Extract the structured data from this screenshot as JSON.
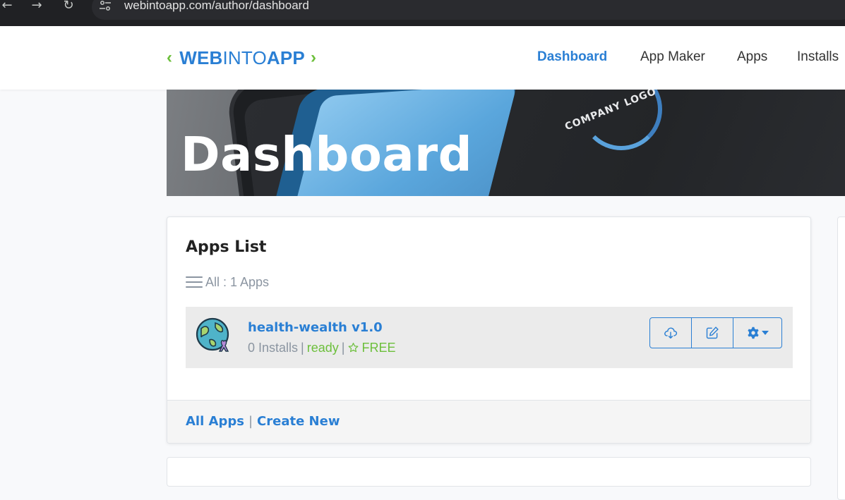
{
  "browser": {
    "url": "webintoapp.com/author/dashboard",
    "back_icon": "arrow-left-icon",
    "forward_icon": "arrow-right-icon",
    "reload_icon": "reload-icon"
  },
  "brand": {
    "logo_left_chevron": "‹",
    "logo_part1": "WEB",
    "logo_part2": "INTO",
    "logo_part3": "APP",
    "logo_right_chevron": "›",
    "primary_color": "#2a7fd4",
    "accent_color": "#6cbf3b"
  },
  "nav": {
    "items": [
      {
        "label": "Dashboard",
        "active": true
      },
      {
        "label": "App Maker",
        "active": false
      },
      {
        "label": "Apps",
        "active": false
      },
      {
        "label": "Installs",
        "active": false
      }
    ]
  },
  "hero": {
    "title": "Dashboard",
    "image_text": "COMPANY LOGO"
  },
  "apps_list": {
    "title": "Apps List",
    "filter_label": "All : 1 Apps",
    "apps": [
      {
        "name": "health-wealth v1.0",
        "installs": "0 Installs",
        "status": "ready",
        "plan": "FREE",
        "separator": "|"
      }
    ],
    "footer": {
      "all_apps": "All Apps",
      "separator": "|",
      "create_new": "Create New"
    }
  }
}
